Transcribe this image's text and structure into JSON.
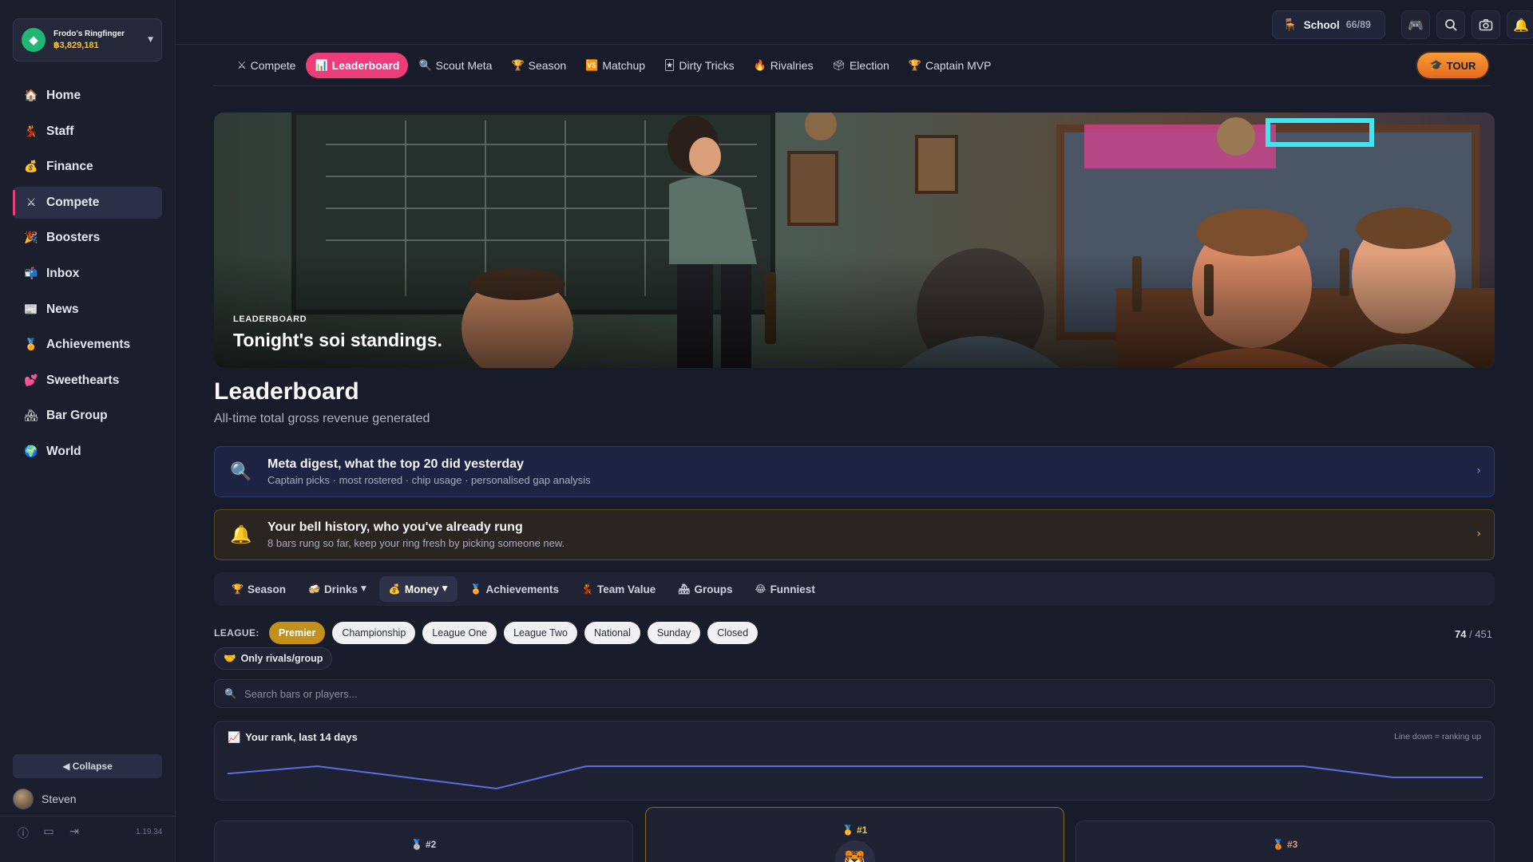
{
  "account": {
    "name": "Frodo's Ringfinger",
    "balance": "฿3,829,181",
    "gem_icon": "gem-icon"
  },
  "sidebar": {
    "items": [
      {
        "label": "Home",
        "icon": "🏠",
        "active": false
      },
      {
        "label": "Staff",
        "icon": "💃",
        "active": false
      },
      {
        "label": "Finance",
        "icon": "💰",
        "active": false
      },
      {
        "label": "Compete",
        "icon": "⚔",
        "active": true
      },
      {
        "label": "Boosters",
        "icon": "🎉",
        "active": false
      },
      {
        "label": "Inbox",
        "icon": "📬",
        "active": false
      },
      {
        "label": "News",
        "icon": "📰",
        "active": false
      },
      {
        "label": "Achievements",
        "icon": "🏅",
        "active": false
      },
      {
        "label": "Sweethearts",
        "icon": "💕",
        "active": false
      },
      {
        "label": "Bar Group",
        "icon": "🏘",
        "active": false
      },
      {
        "label": "World",
        "icon": "🌍",
        "active": false
      }
    ],
    "collapse_label": "◀ Collapse",
    "user_name": "Steven",
    "version": "1.19.34"
  },
  "topbar": {
    "school_label": "School",
    "school_count": "66/89"
  },
  "subnav": {
    "tabs": [
      {
        "label": "Compete",
        "icon": "⚔"
      },
      {
        "label": "Leaderboard",
        "icon": "📊"
      },
      {
        "label": "Scout Meta",
        "icon": "🔍"
      },
      {
        "label": "Season",
        "icon": "🏆"
      },
      {
        "label": "Matchup",
        "icon": "🆚"
      },
      {
        "label": "Dirty Tricks",
        "icon": "🃏"
      },
      {
        "label": "Rivalries",
        "icon": "🔥"
      },
      {
        "label": "Election",
        "icon": "🗳"
      },
      {
        "label": "Captain MVP",
        "icon": "🏆"
      }
    ],
    "active_index": 1,
    "tour_label": "TOUR"
  },
  "hero": {
    "kicker": "LEADERBOARD",
    "title": "Tonight's soi standings."
  },
  "page": {
    "title": "Leaderboard",
    "subtitle": "All-time total gross revenue generated"
  },
  "banners": {
    "meta": {
      "title": "Meta digest, what the top 20 did yesterday",
      "subtitle": "Captain picks · most rostered · chip usage · personalised gap analysis"
    },
    "bell": {
      "title": "Your bell history, who you've already rung",
      "subtitle": "8 bars rung so far, keep your ring fresh by picking someone new."
    }
  },
  "categories": [
    {
      "label": "Season",
      "icon": "🏆",
      "dropdown": false,
      "active": false
    },
    {
      "label": "Drinks",
      "icon": "🍻",
      "dropdown": true,
      "active": false
    },
    {
      "label": "Money",
      "icon": "💰",
      "dropdown": true,
      "active": true
    },
    {
      "label": "Achievements",
      "icon": "🏅",
      "dropdown": false,
      "active": false
    },
    {
      "label": "Team Value",
      "icon": "💃",
      "dropdown": false,
      "active": false
    },
    {
      "label": "Groups",
      "icon": "🏘",
      "dropdown": false,
      "active": false
    },
    {
      "label": "Funniest",
      "icon": "😂",
      "dropdown": false,
      "active": false
    }
  ],
  "league": {
    "label": "LEAGUE:",
    "options": [
      "Premier",
      "Championship",
      "League One",
      "League Two",
      "National",
      "Sunday",
      "Closed"
    ],
    "selected": "Premier",
    "count_current": "74",
    "count_total": "451",
    "rivals_label": "Only rivals/group"
  },
  "search": {
    "placeholder": "Search bars or players..."
  },
  "rank_chart": {
    "title": "Your rank, last 14 days",
    "hint": "Line down = ranking up",
    "line_color": "#5b6ee0",
    "values": [
      76,
      74,
      77,
      80,
      74,
      74,
      74,
      74,
      74,
      74,
      74,
      74,
      74,
      77,
      77
    ]
  },
  "podium": [
    {
      "rank": "#2",
      "medal": "🥈"
    },
    {
      "rank": "#1",
      "medal": "🥇",
      "avatar": "🐯"
    },
    {
      "rank": "#3",
      "medal": "🥉"
    }
  ]
}
